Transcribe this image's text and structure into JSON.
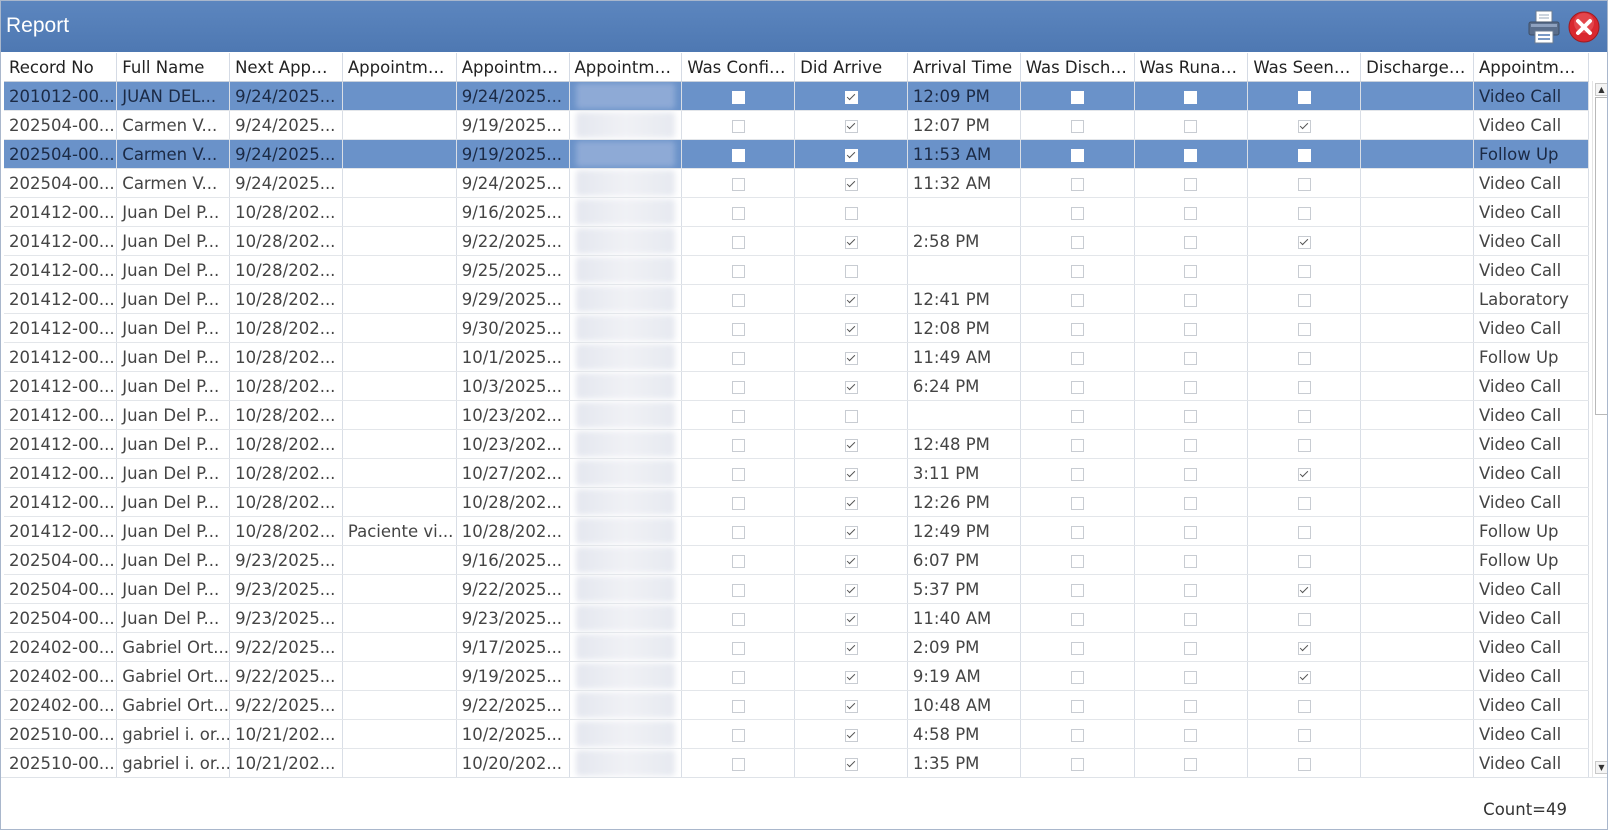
{
  "window": {
    "title": "Report",
    "print_icon": "printer-icon",
    "close_icon": "close-circle-icon"
  },
  "colors": {
    "titlebar": "#4e78b2",
    "selected_row": "#6a92c9",
    "close_red": "#d9282f"
  },
  "grid": {
    "columns": [
      "Record No",
      "Full Name",
      "Next Appoi...",
      "Appointme...",
      "Appointme...",
      "Appointme...",
      "Was Confir...",
      "Did Arrive",
      "Arrival Time",
      "Was Discha...",
      "Was Runaw...",
      "Was Seen B...",
      "Discharged...",
      "Appointme..."
    ],
    "rows": [
      {
        "record": "201012-00...",
        "name": "JUAN DEL...",
        "next": "9/24/2025...",
        "note": "",
        "date": "9/24/2025...",
        "confirmed": false,
        "arrived": true,
        "time": "12:09 PM",
        "discharged": false,
        "runaway": false,
        "seen": false,
        "dis_by": "",
        "type": "Video Call",
        "selected": true
      },
      {
        "record": "202504-00...",
        "name": "Carmen V...",
        "next": "9/24/2025...",
        "note": "",
        "date": "9/19/2025...",
        "confirmed": false,
        "arrived": true,
        "time": "12:07 PM",
        "discharged": false,
        "runaway": false,
        "seen": true,
        "dis_by": "",
        "type": "Video Call",
        "selected": false
      },
      {
        "record": "202504-00...",
        "name": "Carmen V...",
        "next": "9/24/2025...",
        "note": "",
        "date": "9/19/2025...",
        "confirmed": false,
        "arrived": true,
        "time": "11:53 AM",
        "discharged": false,
        "runaway": false,
        "seen": false,
        "dis_by": "",
        "type": "Follow Up",
        "selected": true
      },
      {
        "record": "202504-00...",
        "name": "Carmen V...",
        "next": "9/24/2025...",
        "note": "",
        "date": "9/24/2025...",
        "confirmed": false,
        "arrived": true,
        "time": "11:32 AM",
        "discharged": false,
        "runaway": false,
        "seen": false,
        "dis_by": "",
        "type": "Video Call",
        "selected": false
      },
      {
        "record": "201412-00...",
        "name": "Juan Del P...",
        "next": "10/28/202...",
        "note": "",
        "date": "9/16/2025...",
        "confirmed": false,
        "arrived": false,
        "time": "",
        "discharged": false,
        "runaway": false,
        "seen": false,
        "dis_by": "",
        "type": "Video Call",
        "selected": false
      },
      {
        "record": "201412-00...",
        "name": "Juan Del P...",
        "next": "10/28/202...",
        "note": "",
        "date": "9/22/2025...",
        "confirmed": false,
        "arrived": true,
        "time": "2:58 PM",
        "discharged": false,
        "runaway": false,
        "seen": true,
        "dis_by": "",
        "type": "Video Call",
        "selected": false
      },
      {
        "record": "201412-00...",
        "name": "Juan Del P...",
        "next": "10/28/202...",
        "note": "",
        "date": "9/25/2025...",
        "confirmed": false,
        "arrived": false,
        "time": "",
        "discharged": false,
        "runaway": false,
        "seen": false,
        "dis_by": "",
        "type": "Video Call",
        "selected": false
      },
      {
        "record": "201412-00...",
        "name": "Juan Del P...",
        "next": "10/28/202...",
        "note": "",
        "date": "9/29/2025...",
        "confirmed": false,
        "arrived": true,
        "time": "12:41 PM",
        "discharged": false,
        "runaway": false,
        "seen": false,
        "dis_by": "",
        "type": "Laboratory",
        "selected": false
      },
      {
        "record": "201412-00...",
        "name": "Juan Del P...",
        "next": "10/28/202...",
        "note": "",
        "date": "9/30/2025...",
        "confirmed": false,
        "arrived": true,
        "time": "12:08 PM",
        "discharged": false,
        "runaway": false,
        "seen": false,
        "dis_by": "",
        "type": "Video Call",
        "selected": false
      },
      {
        "record": "201412-00...",
        "name": "Juan Del P...",
        "next": "10/28/202...",
        "note": "",
        "date": "10/1/2025...",
        "confirmed": false,
        "arrived": true,
        "time": "11:49 AM",
        "discharged": false,
        "runaway": false,
        "seen": false,
        "dis_by": "",
        "type": "Follow Up",
        "selected": false
      },
      {
        "record": "201412-00...",
        "name": "Juan Del P...",
        "next": "10/28/202...",
        "note": "",
        "date": "10/3/2025...",
        "confirmed": false,
        "arrived": true,
        "time": "6:24 PM",
        "discharged": false,
        "runaway": false,
        "seen": false,
        "dis_by": "",
        "type": "Video Call",
        "selected": false
      },
      {
        "record": "201412-00...",
        "name": "Juan Del P...",
        "next": "10/28/202...",
        "note": "",
        "date": "10/23/202...",
        "confirmed": false,
        "arrived": false,
        "time": "",
        "discharged": false,
        "runaway": false,
        "seen": false,
        "dis_by": "",
        "type": "Video Call",
        "selected": false
      },
      {
        "record": "201412-00...",
        "name": "Juan Del P...",
        "next": "10/28/202...",
        "note": "",
        "date": "10/23/202...",
        "confirmed": false,
        "arrived": true,
        "time": "12:48 PM",
        "discharged": false,
        "runaway": false,
        "seen": false,
        "dis_by": "",
        "type": "Video Call",
        "selected": false
      },
      {
        "record": "201412-00...",
        "name": "Juan Del P...",
        "next": "10/28/202...",
        "note": "",
        "date": "10/27/202...",
        "confirmed": false,
        "arrived": true,
        "time": "3:11 PM",
        "discharged": false,
        "runaway": false,
        "seen": true,
        "dis_by": "",
        "type": "Video Call",
        "selected": false
      },
      {
        "record": "201412-00...",
        "name": "Juan Del P...",
        "next": "10/28/202...",
        "note": "",
        "date": "10/28/202...",
        "confirmed": false,
        "arrived": true,
        "time": "12:26 PM",
        "discharged": false,
        "runaway": false,
        "seen": false,
        "dis_by": "",
        "type": "Video Call",
        "selected": false
      },
      {
        "record": "201412-00...",
        "name": "Juan Del P...",
        "next": "10/28/202...",
        "note": "Paciente vi...",
        "date": "10/28/202...",
        "confirmed": false,
        "arrived": true,
        "time": "12:49 PM",
        "discharged": false,
        "runaway": false,
        "seen": false,
        "dis_by": "",
        "type": "Follow Up",
        "selected": false
      },
      {
        "record": "202504-00...",
        "name": "Juan Del P...",
        "next": "9/23/2025...",
        "note": "",
        "date": "9/16/2025...",
        "confirmed": false,
        "arrived": true,
        "time": "6:07 PM",
        "discharged": false,
        "runaway": false,
        "seen": false,
        "dis_by": "",
        "type": "Follow Up",
        "selected": false
      },
      {
        "record": "202504-00...",
        "name": "Juan Del P...",
        "next": "9/23/2025...",
        "note": "",
        "date": "9/22/2025...",
        "confirmed": false,
        "arrived": true,
        "time": "5:37 PM",
        "discharged": false,
        "runaway": false,
        "seen": true,
        "dis_by": "",
        "type": "Video Call",
        "selected": false
      },
      {
        "record": "202504-00...",
        "name": "Juan Del P...",
        "next": "9/23/2025...",
        "note": "",
        "date": "9/23/2025...",
        "confirmed": false,
        "arrived": true,
        "time": "11:40 AM",
        "discharged": false,
        "runaway": false,
        "seen": false,
        "dis_by": "",
        "type": "Video Call",
        "selected": false
      },
      {
        "record": "202402-00...",
        "name": "Gabriel Ort...",
        "next": "9/22/2025...",
        "note": "",
        "date": "9/17/2025...",
        "confirmed": false,
        "arrived": true,
        "time": "2:09 PM",
        "discharged": false,
        "runaway": false,
        "seen": true,
        "dis_by": "",
        "type": "Video Call",
        "selected": false
      },
      {
        "record": "202402-00...",
        "name": "Gabriel Ort...",
        "next": "9/22/2025...",
        "note": "",
        "date": "9/19/2025...",
        "confirmed": false,
        "arrived": true,
        "time": "9:19 AM",
        "discharged": false,
        "runaway": false,
        "seen": true,
        "dis_by": "",
        "type": "Video Call",
        "selected": false
      },
      {
        "record": "202402-00...",
        "name": "Gabriel Ort...",
        "next": "9/22/2025...",
        "note": "",
        "date": "9/22/2025...",
        "confirmed": false,
        "arrived": true,
        "time": "10:48 AM",
        "discharged": false,
        "runaway": false,
        "seen": false,
        "dis_by": "",
        "type": "Video Call",
        "selected": false
      },
      {
        "record": "202510-00...",
        "name": "gabriel i. or...",
        "next": "10/21/202...",
        "note": "",
        "date": "10/2/2025...",
        "confirmed": false,
        "arrived": true,
        "time": "4:58 PM",
        "discharged": false,
        "runaway": false,
        "seen": false,
        "dis_by": "",
        "type": "Video Call",
        "selected": false
      },
      {
        "record": "202510-00...",
        "name": "gabriel i. or...",
        "next": "10/21/202...",
        "note": "",
        "date": "10/20/202...",
        "confirmed": false,
        "arrived": true,
        "time": "1:35 PM",
        "discharged": false,
        "runaway": false,
        "seen": false,
        "dis_by": "",
        "type": "Video Call",
        "selected": false
      }
    ]
  },
  "footer": {
    "count": "Count=49"
  }
}
